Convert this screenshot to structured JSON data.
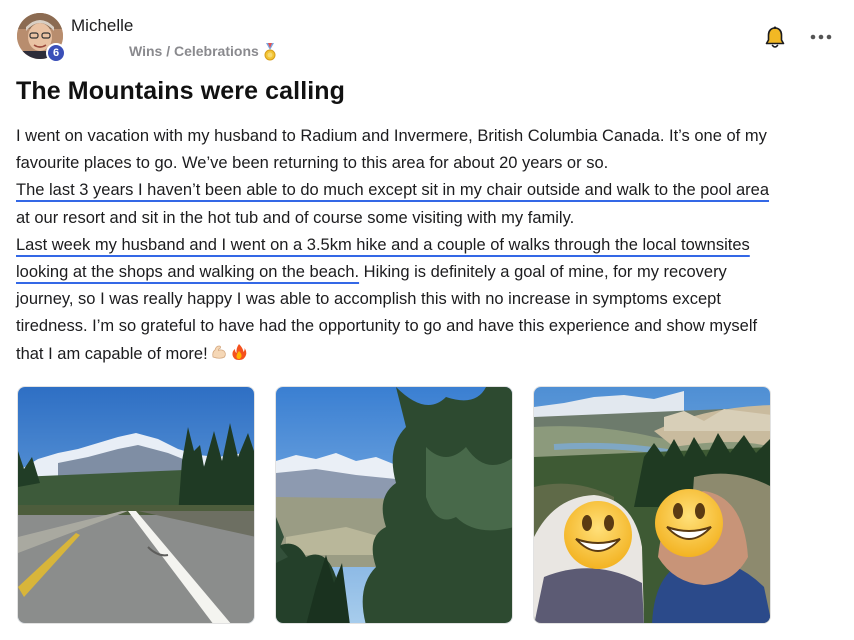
{
  "post": {
    "author": "Michelle",
    "level": "6",
    "category": "Wins / Celebrations",
    "title": "The Mountains were calling",
    "lines": [
      "I went on vacation with my husband to Radium and Invermere, British Columbia Canada. It’s one of my",
      "favourite places to go. We’ve been returning to this area for about 20 years or so.",
      "The last 3 years I haven’t been able to do much except sit in my chair outside and walk to the pool area",
      "at our resort and sit in the hot tub and of course some visiting with my family.",
      "Last week my husband and I went on a 3.5km hike and a couple of walks through the local townsites",
      "looking at the shops and walking on the beach.",
      " Hiking is definitely a goal of mine, for my recovery",
      "journey, so I was really happy I was able to accomplish this with no increase in symptoms except",
      "tiredness. I’m so grateful to have had the opportunity to go and have this experience and show myself",
      "that I am capable of more!"
    ],
    "emojis": [
      "flexed-biceps-emoji",
      "fire-emoji"
    ]
  },
  "icons": {
    "bell": "bell-icon",
    "more": "more-options-icon",
    "medal": "medal-icon"
  },
  "colors": {
    "underline": "#3468e6",
    "badge": "#3a4fb8",
    "bell": "#f2b824",
    "category_text": "#8a8a8e"
  },
  "photos": [
    {
      "name": "photo-mountain-road"
    },
    {
      "name": "photo-mountain-valley-trees"
    },
    {
      "name": "photo-selfie-couple"
    }
  ]
}
